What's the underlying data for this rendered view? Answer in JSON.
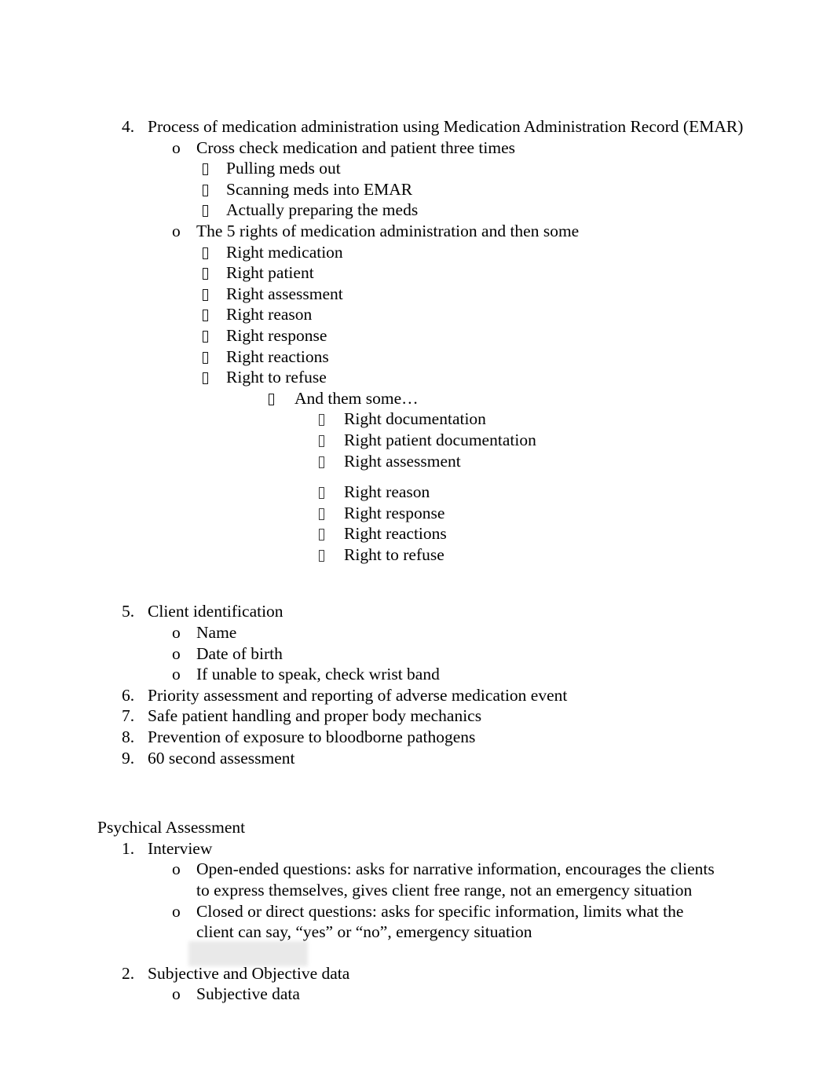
{
  "document": {
    "bullet_glyphs": {
      "numbered": [
        "4.",
        "5.",
        "6.",
        "7.",
        "8.",
        "9.",
        "1.",
        "2."
      ],
      "circle": "o",
      "box": "missing-glyph-box"
    },
    "blocks": [
      {
        "id": "item4",
        "marker": "4.",
        "text": "Process of medication administration using Medication Administration Record (EMAR)"
      },
      {
        "id": "item4-sub1",
        "marker": "o",
        "text": "Cross check medication and patient three times"
      },
      {
        "id": "item4-sub1-a",
        "text": "Pulling meds out"
      },
      {
        "id": "item4-sub1-b",
        "text": "Scanning meds into EMAR"
      },
      {
        "id": "item4-sub1-c",
        "text": "Actually preparing the meds"
      },
      {
        "id": "item4-sub2",
        "marker": "o",
        "text": "The 5 rights of medication administration and then some"
      },
      {
        "id": "rights-1",
        "text": "Right medication"
      },
      {
        "id": "rights-2",
        "text": "Right patient"
      },
      {
        "id": "rights-3",
        "text": "Right assessment"
      },
      {
        "id": "rights-4",
        "text": "Right reason"
      },
      {
        "id": "rights-5",
        "text": "Right response"
      },
      {
        "id": "rights-6",
        "text": "Right reactions"
      },
      {
        "id": "rights-7",
        "text": "Right to refuse"
      },
      {
        "id": "and-them-some",
        "text": "And them some…"
      },
      {
        "id": "more-1",
        "text": "Right documentation"
      },
      {
        "id": "more-2",
        "text": "Right patient documentation"
      },
      {
        "id": "more-3",
        "text": "Right assessment"
      },
      {
        "id": "more-4",
        "text": "Right reason"
      },
      {
        "id": "more-5",
        "text": "Right response"
      },
      {
        "id": "more-6",
        "text": "Right reactions"
      },
      {
        "id": "more-7",
        "text": "Right to refuse"
      },
      {
        "id": "item5",
        "marker": "5.",
        "text": "Client identification"
      },
      {
        "id": "item5-a",
        "marker": "o",
        "text": "Name"
      },
      {
        "id": "item5-b",
        "marker": "o",
        "text": "Date of birth"
      },
      {
        "id": "item5-c",
        "marker": "o",
        "text": "If unable to speak, check wrist band"
      },
      {
        "id": "item6",
        "marker": "6.",
        "text": "Priority assessment and reporting of adverse medication event"
      },
      {
        "id": "item7",
        "marker": "7.",
        "text": "Safe patient handling and proper body mechanics"
      },
      {
        "id": "item8",
        "marker": "8.",
        "text": "Prevention of exposure to bloodborne pathogens"
      },
      {
        "id": "item9",
        "marker": "9.",
        "text": "60 second assessment"
      },
      {
        "id": "section-heading",
        "text": "Psychical Assessment"
      },
      {
        "id": "pa-item1",
        "marker": "1.",
        "text": "Interview"
      },
      {
        "id": "pa-item1-a",
        "marker": "o",
        "text": "Open-ended questions: asks for narrative information, encourages the clients to express themselves, gives client free range, not an emergency situation"
      },
      {
        "id": "pa-item1-b",
        "marker": "o",
        "text": "Closed or direct questions: asks for specific information, limits what the client can say, “yes” or “no”, emergency situation"
      },
      {
        "id": "pa-item2",
        "marker": "2.",
        "text": "Subjective and Objective data"
      },
      {
        "id": "pa-item2-a",
        "marker": "o",
        "text": "Subjective data"
      }
    ]
  }
}
